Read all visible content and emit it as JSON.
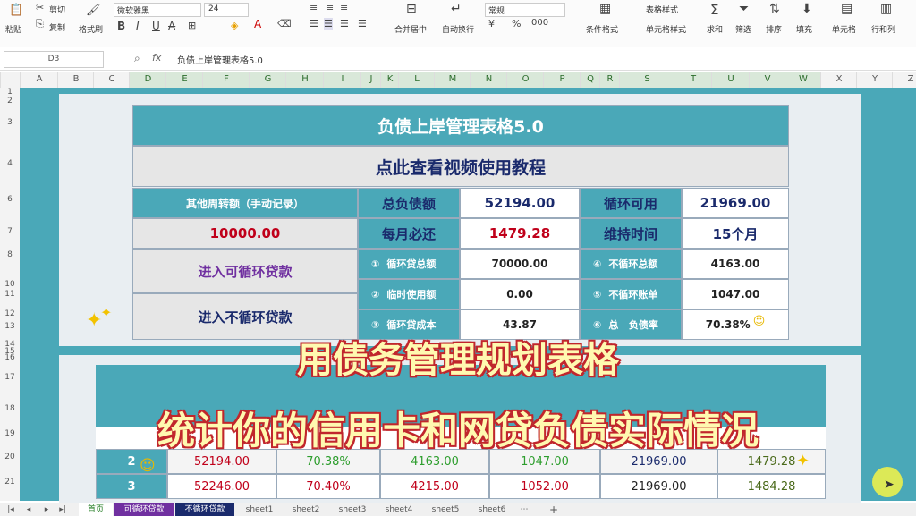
{
  "ribbon": {
    "paste": "粘贴",
    "cut": "剪切",
    "copy": "复制",
    "format_painter": "格式刷",
    "font_name": "微软雅黑",
    "font_size": "24",
    "merge_center": "合并居中",
    "wrap": "自动换行",
    "number_format": "常规",
    "cond_format": "条件格式",
    "table_style": "表格样式",
    "cell_style": "单元格样式",
    "sum": "求和",
    "filter": "筛选",
    "sort": "排序",
    "fill": "填充",
    "cell": "单元格",
    "row_col": "行和列"
  },
  "formula_bar": {
    "name_box": "D3",
    "fx": "fx",
    "content": "负债上岸管理表格5.0"
  },
  "columns": [
    "A",
    "B",
    "C",
    "D",
    "E",
    "F",
    "G",
    "H",
    "I",
    "J",
    "K",
    "L",
    "M",
    "N",
    "O",
    "P",
    "Q",
    "R",
    "S",
    "T",
    "U",
    "V",
    "W",
    "X",
    "Y",
    "Z"
  ],
  "rows": [
    "1",
    "2",
    "3",
    "4",
    "6",
    "7",
    "8",
    "10",
    "11",
    "12",
    "13",
    "14",
    "15",
    "16",
    "17",
    "18",
    "19",
    "20",
    "21"
  ],
  "dashboard": {
    "title": "负债上岸管理表格5.0",
    "video_link": "点此查看视频使用教程",
    "other_label": "其他周转额（手动记录）",
    "other_value": "10000.00",
    "enter_revolving": "进入可循环贷款",
    "enter_nonrevolving": "进入不循环贷款",
    "total_debt_label": "总负债额",
    "total_debt": "52194.00",
    "monthly_label": "每月必还",
    "monthly": "1479.28",
    "revolving_avail_label": "循环可用",
    "revolving_avail": "21969.00",
    "duration_label": "维持时间",
    "duration": "15个月",
    "items": [
      {
        "icon": "①",
        "label": "循环贷总额",
        "value": "70000.00"
      },
      {
        "icon": "②",
        "label": "临时使用额",
        "value": "0.00"
      },
      {
        "icon": "③",
        "label": "循环贷成本",
        "value": "43.87"
      },
      {
        "icon": "④",
        "label": "不循环总额",
        "value": "4163.00"
      },
      {
        "icon": "⑤",
        "label": "不循环账单",
        "value": "1047.00"
      },
      {
        "icon": "⑥",
        "label": "总   负债率",
        "value": "70.38%"
      }
    ]
  },
  "history": {
    "rows": [
      {
        "no": "2",
        "c1": "52194.00",
        "c2": "70.38%",
        "c3": "4163.00",
        "c4": "1047.00",
        "c5": "21969.00",
        "c6": "1479.28"
      },
      {
        "no": "3",
        "c1": "52246.00",
        "c2": "70.40%",
        "c3": "4215.00",
        "c4": "1052.00",
        "c5": "21969.00",
        "c6": "1484.28"
      }
    ]
  },
  "overlay": {
    "line1": "用债务管理规划表格",
    "line2": "统计你的信用卡和网贷负债实际情况"
  },
  "sheet_tabs": [
    "首页",
    "可循环贷款",
    "不循环贷款",
    "sheet1",
    "sheet2",
    "sheet3",
    "sheet4",
    "sheet5",
    "sheet6"
  ],
  "colors": {
    "teal": "#4aa8b8",
    "red": "#c0001a",
    "purple": "#7030a0",
    "navy": "#1a2a6c",
    "green": "#2e9e2e"
  }
}
